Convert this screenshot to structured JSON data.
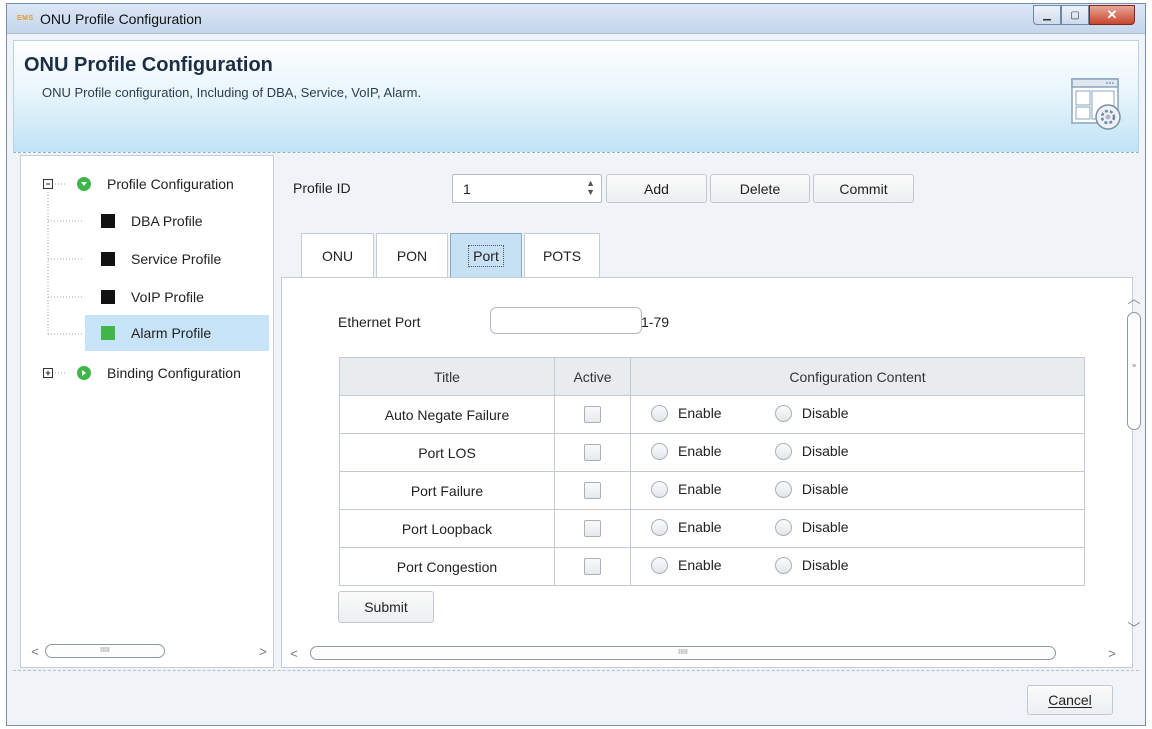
{
  "window": {
    "title": "ONU Profile Configuration",
    "app_badge": "EMS"
  },
  "header": {
    "title": "ONU Profile Configuration",
    "subtitle": "ONU Profile configuration, Including of DBA, Service, VoIP, Alarm."
  },
  "tree": {
    "items": [
      {
        "label": "Profile Configuration",
        "type": "group",
        "expanded": true
      },
      {
        "label": "DBA Profile",
        "type": "leaf",
        "color": "#111111"
      },
      {
        "label": "Service Profile",
        "type": "leaf",
        "color": "#111111"
      },
      {
        "label": "VoIP Profile",
        "type": "leaf",
        "color": "#111111"
      },
      {
        "label": "Alarm Profile",
        "type": "leaf",
        "color": "#3fb54a",
        "selected": true
      },
      {
        "label": "Binding Configuration",
        "type": "group",
        "expanded": false
      }
    ]
  },
  "profile": {
    "id_label": "Profile ID",
    "id_value": "1",
    "add_label": "Add",
    "delete_label": "Delete",
    "commit_label": "Commit"
  },
  "tabs": [
    {
      "label": "ONU"
    },
    {
      "label": "PON"
    },
    {
      "label": "Port",
      "active": true
    },
    {
      "label": "POTS"
    }
  ],
  "port": {
    "ethernet_label": "Ethernet Port",
    "ethernet_value": "",
    "range_hint": "1-79",
    "columns": {
      "title": "Title",
      "active": "Active",
      "config": "Configuration Content"
    },
    "enable_label": "Enable",
    "disable_label": "Disable",
    "rows": [
      {
        "title": "Auto Negate Failure"
      },
      {
        "title": "Port LOS"
      },
      {
        "title": "Port Failure"
      },
      {
        "title": "Port Loopback"
      },
      {
        "title": "Port Congestion"
      }
    ],
    "submit_label": "Submit"
  },
  "footer": {
    "cancel_label": "Cancel"
  },
  "colors": {
    "selected_row": "#c7e3f7",
    "active_tab": "#c6e1f3",
    "header_gradient_end": "#bfe3f5"
  }
}
